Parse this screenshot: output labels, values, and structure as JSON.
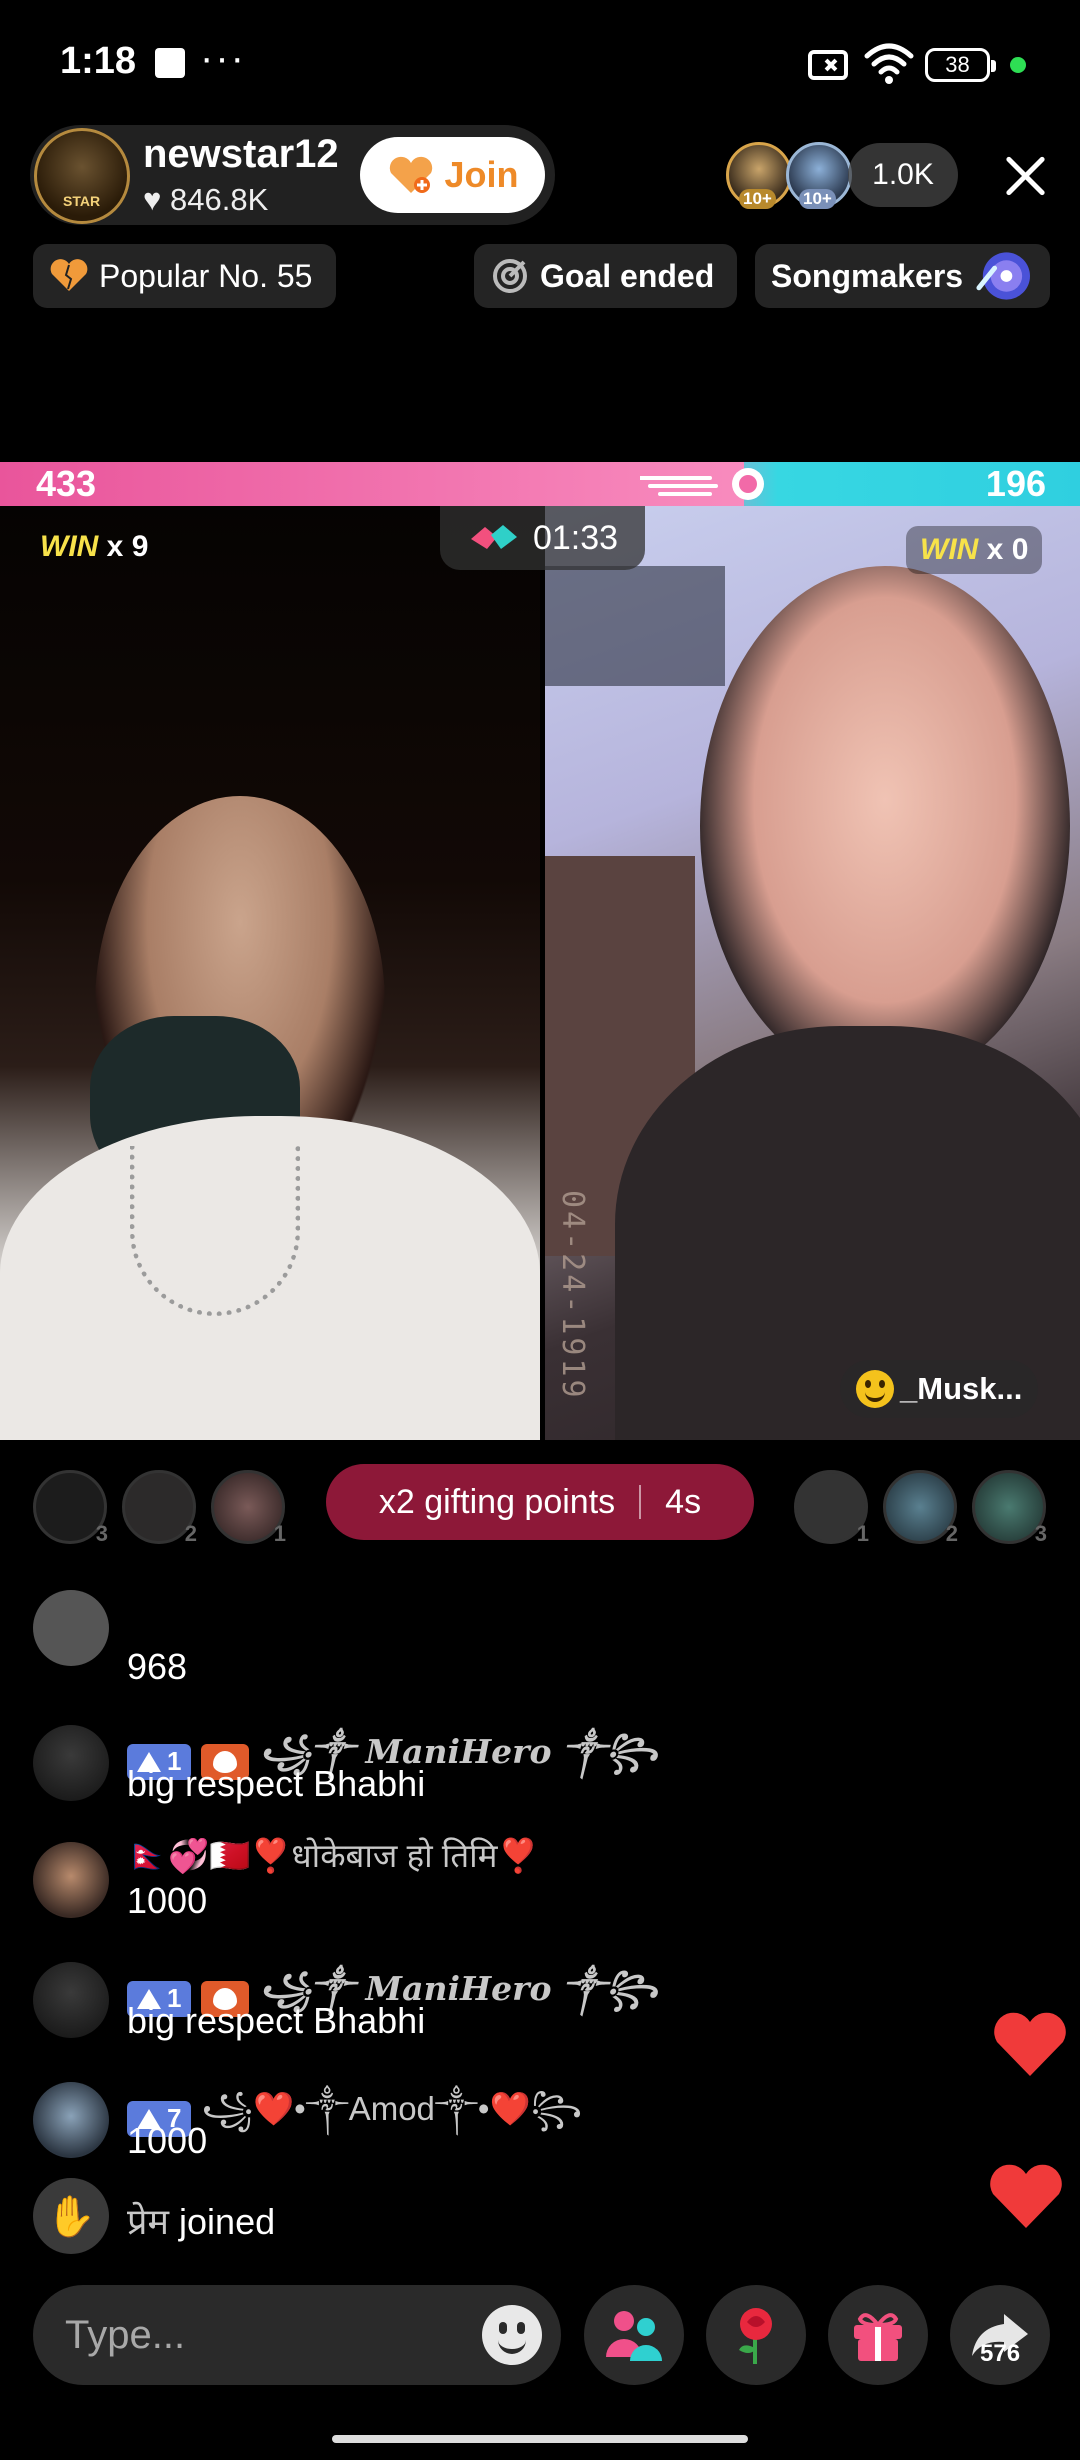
{
  "status_bar": {
    "time": "1:18",
    "more": "···",
    "battery": "38"
  },
  "host": {
    "name": "newstar12",
    "likes": "846.8K",
    "join_label": "Join",
    "avatar_tag": "STAR"
  },
  "viewers": {
    "top1_badge": "10+",
    "top2_badge": "10+",
    "count": "1.0K"
  },
  "chips": {
    "popular": "Popular No. 55",
    "goal": "Goal ended",
    "song": "Songmakers"
  },
  "battle": {
    "left_score": "433",
    "right_score": "196",
    "left_ratio": 0.6885,
    "timer": "01:33",
    "win_word": "WIN",
    "left_wins": "x 9",
    "right_wins": "x 0",
    "right_name": "_Musk...",
    "watermark": "04-24-1919"
  },
  "gifters": {
    "left_ranks": [
      "3",
      "2",
      "1"
    ],
    "right_ranks": [
      "1",
      "2",
      "3"
    ]
  },
  "gift_points": {
    "label": "x2 gifting points",
    "time": "4s"
  },
  "chat": {
    "partial_text": "968",
    "messages": [
      {
        "level": "1",
        "user": "꧁༒ ManiHero ༒꧂",
        "text": "big respect Bhabhi"
      },
      {
        "user": "🇳🇵💞🇧🇭❣️धोकेबाज हो तिमि❣️",
        "text": "1000"
      },
      {
        "level": "1",
        "user": "꧁༒ ManiHero ༒꧂",
        "text": "big respect Bhabhi"
      },
      {
        "level": "7",
        "user": "꧁❤️•༒Amod༒•❤️꧂",
        "text": "1000"
      }
    ],
    "join_user": "प्रेम",
    "join_text": "joined"
  },
  "bottom": {
    "placeholder": "Type...",
    "share_count": "576"
  },
  "colors": {
    "pink": "#f26aa8",
    "cyan": "#37d7e2",
    "gift_pill": "#8d1838",
    "join_orange": "#ee8a28",
    "level_badge": "#5b7bdc"
  }
}
